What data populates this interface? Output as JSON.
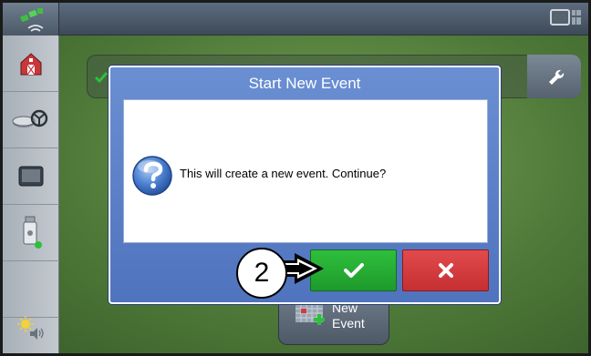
{
  "dialog": {
    "title": "Start New Event",
    "message": "This will create a new event. Continue?",
    "confirm_icon": "checkmark-icon",
    "cancel_icon": "x-icon"
  },
  "background": {
    "new_event_label": "New Event",
    "wrench_icon": "wrench-icon"
  },
  "sidebar": {
    "items": [
      {
        "name": "farm-icon"
      },
      {
        "name": "steering-icon"
      },
      {
        "name": "display-icon"
      },
      {
        "name": "usb-drive-icon"
      },
      {
        "name": "empty"
      },
      {
        "name": "brightness-volume-icon"
      }
    ]
  },
  "callout": {
    "number": "2"
  },
  "colors": {
    "dialog_blue": "#5b80c8",
    "confirm_green": "#27ae35",
    "cancel_red": "#d63c3f"
  }
}
